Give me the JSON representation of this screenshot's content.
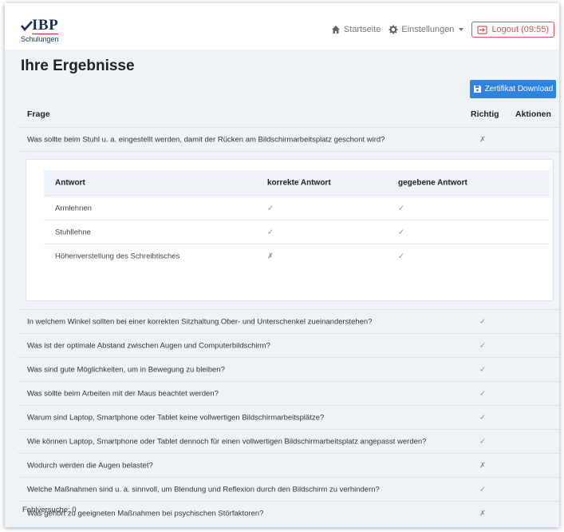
{
  "brand": {
    "logo_main": "IBP",
    "logo_sub": "Schulungen"
  },
  "nav": {
    "home": "Startseite",
    "settings": "Einstellungen",
    "logout": "Logout (09:55)"
  },
  "page": {
    "title": "Ihre Ergebnisse",
    "certificate_button": "Zertifikat Download",
    "footer": "Fehlversuche: 0"
  },
  "table": {
    "headers": {
      "question": "Frage",
      "correct": "Richtig",
      "actions": "Aktionen"
    },
    "first_row": {
      "question": "Was sollte beim Stuhl u. a. eingestellt werden, damit der Rücken am Bildschirmarbeitsplatz geschont wird?",
      "correct": "✗"
    },
    "detail": {
      "headers": {
        "answer": "Antwort",
        "correct_answer": "korrekte Antwort",
        "given_answer": "gegebene Antwort"
      },
      "rows": [
        {
          "answer": "Armlehnen",
          "correct_answer": "✓",
          "given_answer": "✓"
        },
        {
          "answer": "Stuhllehne",
          "correct_answer": "✓",
          "given_answer": "✓"
        },
        {
          "answer": "Höhenverstellung des Schreibtisches",
          "correct_answer": "✗",
          "given_answer": "✓"
        }
      ]
    },
    "rows": [
      {
        "question": "In welchem Winkel sollten bei einer korrekten Sitzhaltung Ober- und Unterschenkel zueinanderstehen?",
        "correct": "✓"
      },
      {
        "question": "Was ist der optimale Abstand zwischen Augen und Computerbildschirm?",
        "correct": "✓"
      },
      {
        "question": "Was sind gute Möglichkeiten, um in Bewegung zu bleiben?",
        "correct": "✓"
      },
      {
        "question": "Was sollte beim Arbeiten mit der Maus beachtet werden?",
        "correct": "✓"
      },
      {
        "question": "Warum sind Laptop, Smartphone oder Tablet keine vollwertigen Bildschirmarbeitsplätze?",
        "correct": "✓"
      },
      {
        "question": "Wie können Laptop, Smartphone oder Tablet dennoch für einen vollwertigen Bildschirmarbeitsplatz angepasst werden?",
        "correct": "✓"
      },
      {
        "question": "Wodurch werden die Augen belastet?",
        "correct": "✗"
      },
      {
        "question": "Welche Maßnahmen sind u. a. sinnvoll, um Blendung und Reflexion durch den Bildschirm zu verhindern?",
        "correct": "✓"
      },
      {
        "question": "Was gehört zu geeigneten Maßnahmen bei psychischen Störfaktoren?",
        "correct": "✗"
      }
    ]
  },
  "colors": {
    "primary": "#2f82e0",
    "danger": "#d9534f",
    "background": "#eef3f8",
    "brand": "#1b2f5b"
  }
}
